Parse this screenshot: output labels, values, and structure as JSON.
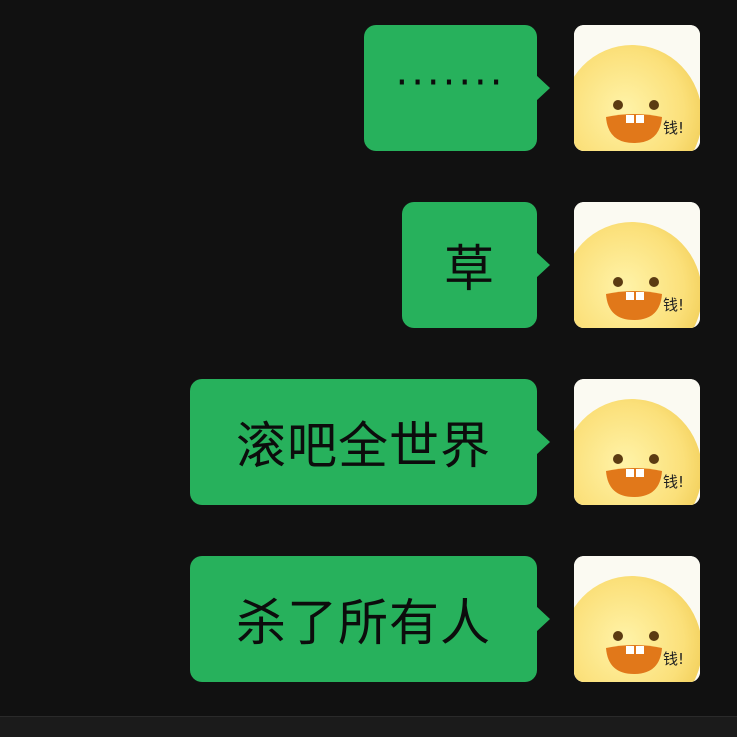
{
  "colors": {
    "background": "#111111",
    "bubble": "#27b15c",
    "text": "#0c0c0c"
  },
  "messages": [
    {
      "text": "·······",
      "sender": "self",
      "avatar_icon": "yellow-chick-money-icon",
      "avatar_caption": "钱!"
    },
    {
      "text": "草",
      "sender": "self",
      "avatar_icon": "yellow-chick-money-icon",
      "avatar_caption": "钱!"
    },
    {
      "text": "滚吧全世界",
      "sender": "self",
      "avatar_icon": "yellow-chick-money-icon",
      "avatar_caption": "钱!"
    },
    {
      "text": "杀了所有人",
      "sender": "self",
      "avatar_icon": "yellow-chick-money-icon",
      "avatar_caption": "钱!"
    }
  ]
}
